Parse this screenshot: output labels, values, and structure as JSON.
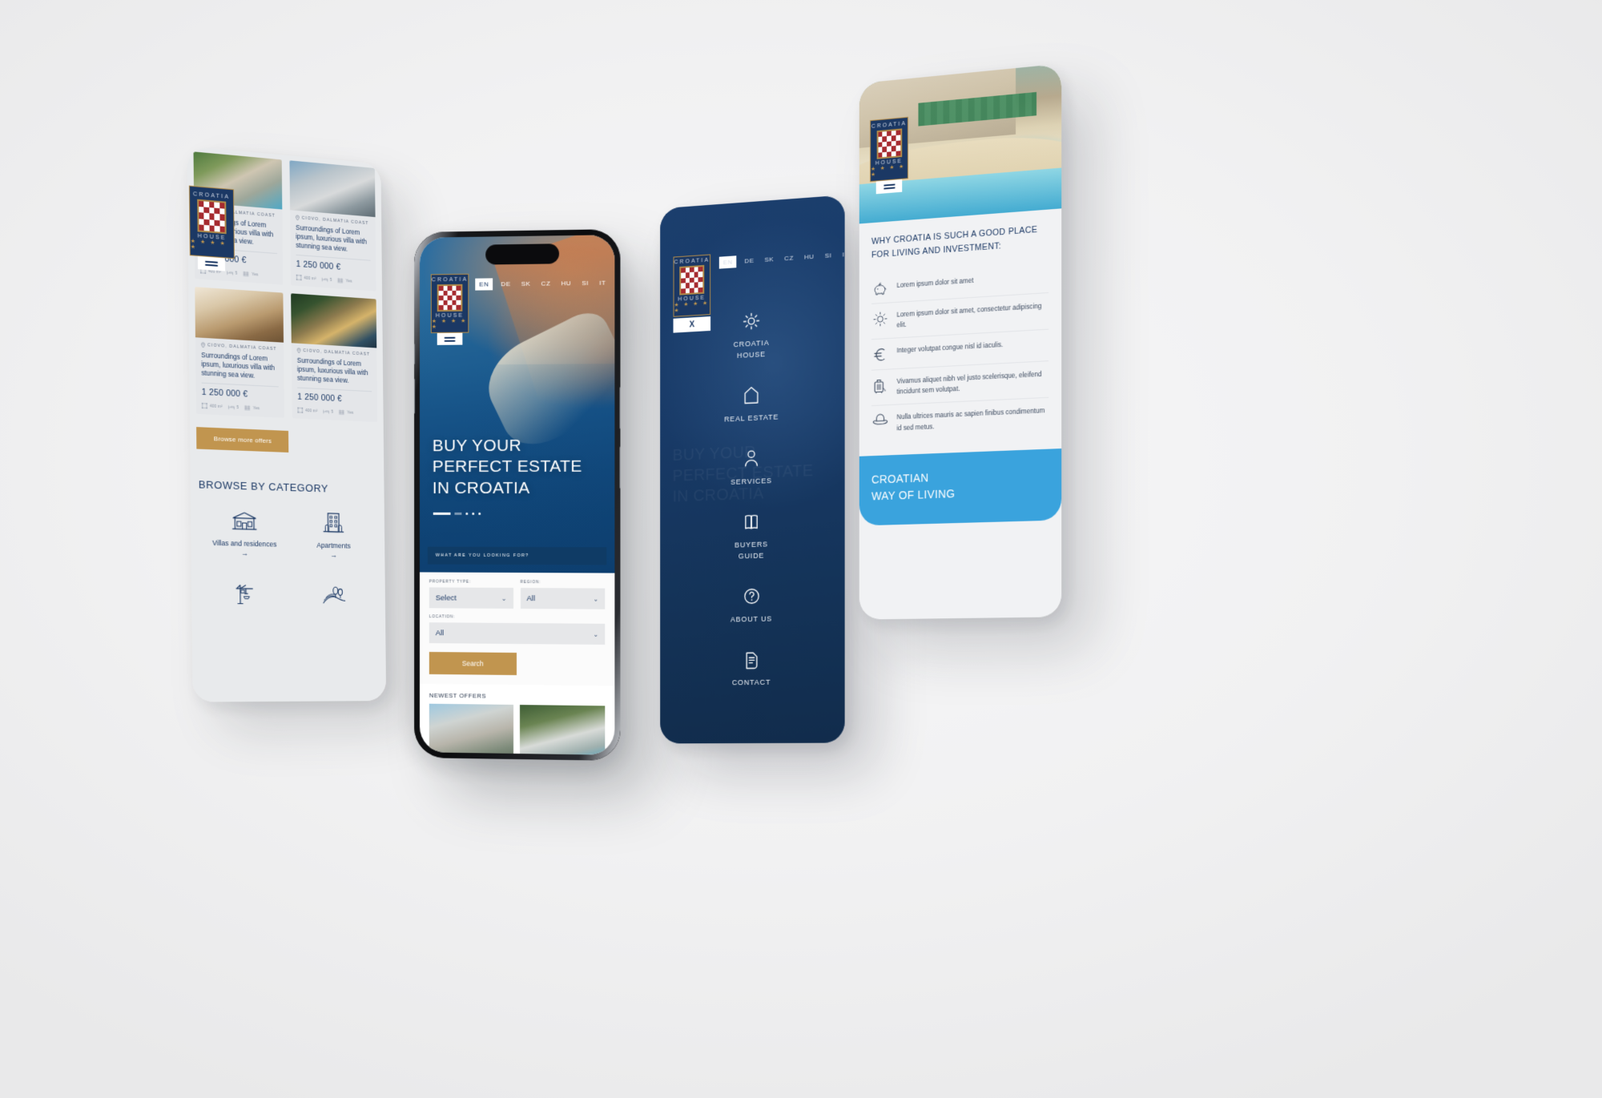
{
  "brand": {
    "name_top": "CROATIA",
    "name_bottom": "HOUSE",
    "stars": "★ ★ ★ ★ ★",
    "accent_gold": "#c1954f",
    "navy": "#1b3864",
    "sky_blue": "#3aa3dd"
  },
  "languages": {
    "active": "EN",
    "items": [
      "EN",
      "DE",
      "SK",
      "CZ",
      "HU",
      "SI",
      "IT"
    ]
  },
  "phone_listings": {
    "cards": [
      {
        "location": "CIOVO, DALMATIA COAST",
        "title": "Surroundings of Lorem ipsum, luxurious villa with stunning sea view.",
        "price": "1 250 000 €",
        "area": "400 m²",
        "bedrooms": "5",
        "pool": "Yes"
      },
      {
        "location": "CIOVO, DALMATIA COAST",
        "title": "Surroundings of Lorem ipsum, luxurious villa with stunning sea view.",
        "price": "1 250 000 €",
        "area": "400 m²",
        "bedrooms": "5",
        "pool": "Yes"
      },
      {
        "location": "CIOVO, DALMATIA COAST",
        "title": "Surroundings of Lorem ipsum, luxurious villa with stunning sea view.",
        "price": "1 250 000 €",
        "area": "400 m²",
        "bedrooms": "5",
        "pool": "Yes"
      },
      {
        "location": "CIOVO, DALMATIA COAST",
        "title": "Surroundings of Lorem ipsum, luxurious villa with stunning sea view.",
        "price": "1 250 000 €",
        "area": "400 m²",
        "bedrooms": "5",
        "pool": "Yes"
      }
    ],
    "browse_more_label": "Browse more offers",
    "category_section_title": "BROWSE BY CATEGORY",
    "categories": [
      {
        "label": "Villas and residences",
        "arrow": "→",
        "icon": "villa-icon"
      },
      {
        "label": "Apartments",
        "arrow": "→",
        "icon": "apartment-building-icon"
      },
      {
        "label": "",
        "arrow": "",
        "icon": "crane-icon"
      },
      {
        "label": "",
        "arrow": "",
        "icon": "land-icon"
      }
    ]
  },
  "phone_home": {
    "hero_title_lines": [
      "BUY YOUR",
      "PERFECT ESTATE",
      "IN CROATIA"
    ],
    "search_header": "WHAT ARE YOU LOOKING FOR?",
    "fields": [
      {
        "label": "PROPERTY TYPE:",
        "value": "Select"
      },
      {
        "label": "REGION:",
        "value": "All"
      },
      {
        "label": "LOCATION:",
        "value": "All"
      }
    ],
    "search_button": "Search",
    "newest_offers_title": "NEWEST OFFERS"
  },
  "phone_menu": {
    "close_label": "X",
    "items": [
      {
        "label": "CROATIA\nHOUSE",
        "icon": "sun-icon"
      },
      {
        "label": "REAL ESTATE",
        "icon": "house-outline-icon"
      },
      {
        "label": "SERVICES",
        "icon": "person-icon"
      },
      {
        "label": "BUYERS\nGUIDE",
        "icon": "book-icon"
      },
      {
        "label": "ABOUT US",
        "icon": "question-circle-icon"
      },
      {
        "label": "CONTACT",
        "icon": "document-icon"
      }
    ]
  },
  "phone_why": {
    "title_lines": [
      "WHY CROATIA IS SUCH A GOOD PLACE",
      "FOR LIVING AND INVESTMENT:"
    ],
    "benefits": [
      {
        "icon": "piggy-bank-icon",
        "text": "Lorem ipsum dolor sit amet"
      },
      {
        "icon": "sun-icon",
        "text": "Lorem ipsum dolor sit amet, consectetur adipiscing elit."
      },
      {
        "icon": "euro-icon",
        "text": "Integer volutpat congue nisl id iaculis."
      },
      {
        "icon": "suitcase-icon",
        "text": "Vivamus aliquet nibh vel justo scelerisque, eleifend tincidunt sem volutpat."
      },
      {
        "icon": "hat-icon",
        "text": "Nulla ultrices mauris ac sapien finibus condimentum id sed metus."
      }
    ],
    "banner_lines": [
      "CROATIAN",
      "WAY OF LIVING"
    ]
  }
}
